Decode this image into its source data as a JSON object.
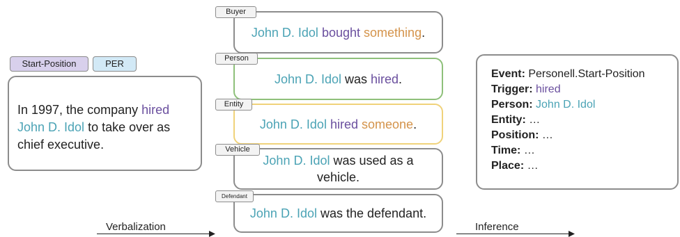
{
  "source": {
    "tags": {
      "event_type": "Start-Position",
      "entity_type": "PER"
    },
    "sentence": {
      "part1": "In 1997, the company ",
      "trigger": "hired",
      "line_break_space": " ",
      "argument": "John D. Idol",
      "part2": " to take over as chief executive."
    }
  },
  "verbalizations": [
    {
      "role": "Buyer",
      "arg": "John D. Idol",
      "mid": " ",
      "verb": "bought",
      "mid2": " ",
      "obj": "something",
      "end": "."
    },
    {
      "role": "Person",
      "arg": "John D. Idol",
      "mid": " was ",
      "verb": "hired",
      "end": "."
    },
    {
      "role": "Entity",
      "arg": "John D. Idol",
      "mid": " ",
      "verb": "hired",
      "mid2": " ",
      "obj": "someone",
      "end": "."
    },
    {
      "role": "Vehicle",
      "arg": "John D. Idol",
      "rest": " was used as a vehicle."
    },
    {
      "role": "Defendant",
      "arg": "John D. Idol",
      "rest": " was the defendant."
    }
  ],
  "output": {
    "event_label": "Event:",
    "event_value": " Personell.Start-Position",
    "trigger_label": "Trigger:",
    "trigger_value": " hired",
    "person_label": "Person:",
    "person_value": " John D. Idol",
    "entity_label": "Entity:",
    "entity_value": " …",
    "position_label": "Position:",
    "position_value": " …",
    "time_label": "Time:",
    "time_value": " …",
    "place_label": "Place:",
    "place_value": " …"
  },
  "flow": {
    "verbalization": "Verbalization",
    "inference": "Inference"
  },
  "colors": {
    "argument": "#4ba3b5",
    "trigger": "#6a4f9e",
    "object": "#d4934a",
    "person_border": "#8ec07a",
    "entity_border": "#f0d27a"
  }
}
